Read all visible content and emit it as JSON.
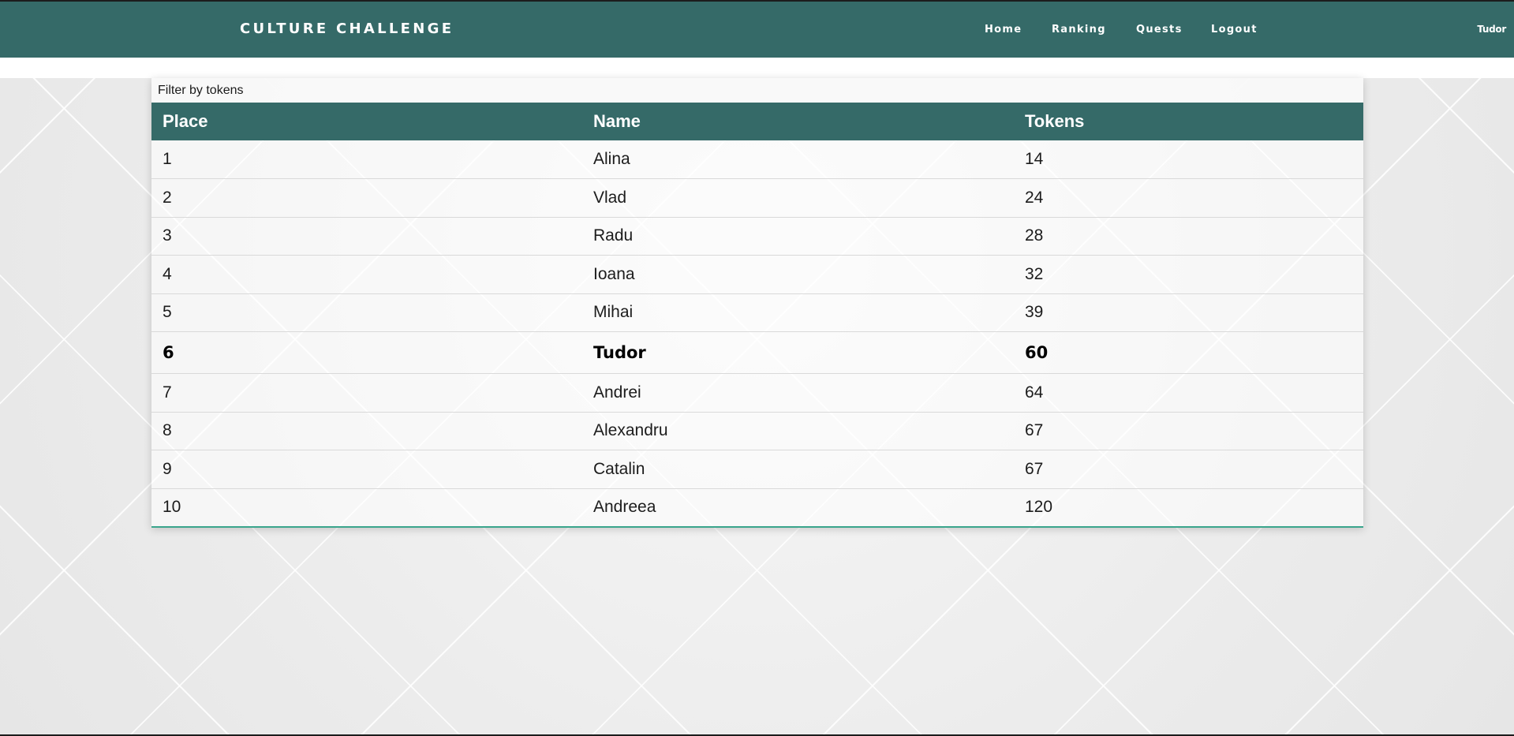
{
  "navbar": {
    "brand": "CULTURE CHALLENGE",
    "links": [
      "Home",
      "Ranking",
      "Quests",
      "Logout"
    ],
    "user": "Tudor"
  },
  "ranking": {
    "filter_label": "Filter by tokens",
    "columns": [
      "Place",
      "Name",
      "Tokens"
    ],
    "rows": [
      {
        "place": "1",
        "name": "Alina",
        "tokens": "14"
      },
      {
        "place": "2",
        "name": "Vlad",
        "tokens": "24"
      },
      {
        "place": "3",
        "name": "Radu",
        "tokens": "28"
      },
      {
        "place": "4",
        "name": "Ioana",
        "tokens": "32"
      },
      {
        "place": "5",
        "name": "Mihai",
        "tokens": "39"
      },
      {
        "place": "6",
        "name": "Tudor",
        "tokens": "60"
      },
      {
        "place": "7",
        "name": "Andrei",
        "tokens": "64"
      },
      {
        "place": "8",
        "name": "Alexandru",
        "tokens": "67"
      },
      {
        "place": "9",
        "name": "Catalin",
        "tokens": "67"
      },
      {
        "place": "10",
        "name": "Andreea",
        "tokens": "120"
      }
    ],
    "highlighted_row": 6
  },
  "colors": {
    "navbar": "#356a68",
    "table_header": "#356a68",
    "accent_line": "#3aa58c"
  }
}
